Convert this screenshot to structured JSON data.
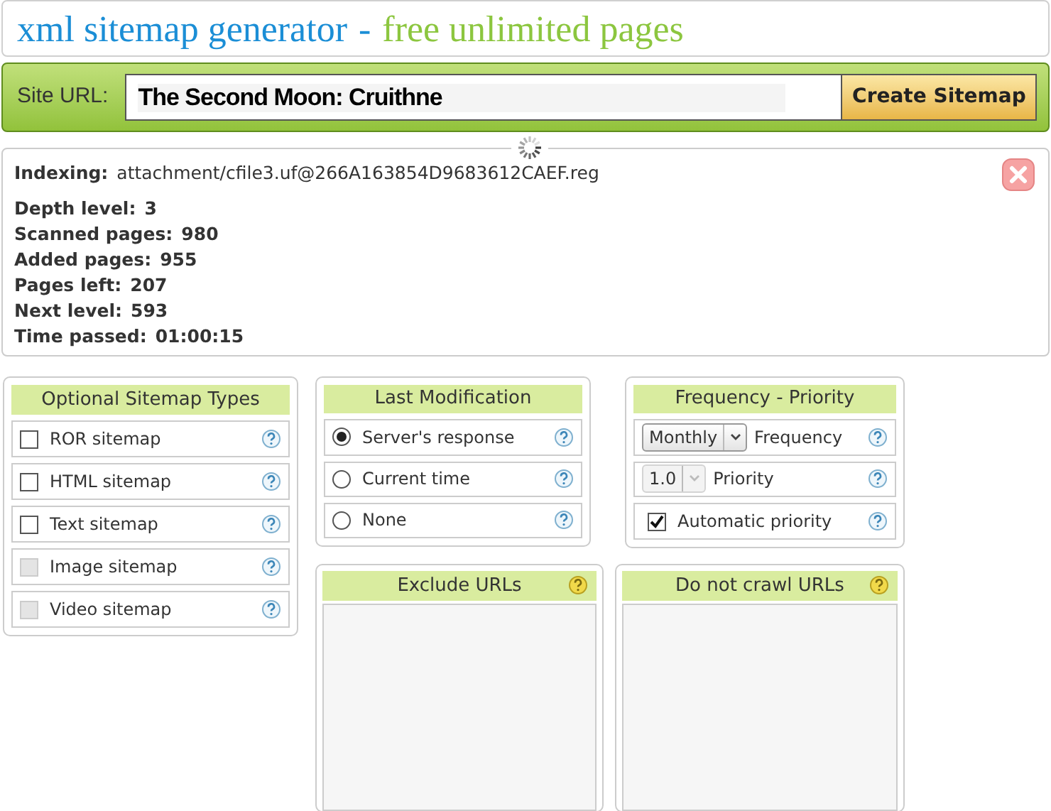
{
  "header": {
    "title": "xml sitemap generator",
    "separator": "-",
    "subtitle": "free unlimited pages"
  },
  "url_bar": {
    "label": "Site URL:",
    "value": "The Second Moon: Cruithne",
    "button": "Create Sitemap"
  },
  "progress": {
    "indexing_label": "Indexing:",
    "indexing_value": "attachment/cfile3.uf@266A163854D9683612CAEF.reg",
    "stats": [
      {
        "label": "Depth level:",
        "value": "3"
      },
      {
        "label": "Scanned pages:",
        "value": "980"
      },
      {
        "label": "Added pages:",
        "value": "955"
      },
      {
        "label": "Pages left:",
        "value": "207"
      },
      {
        "label": "Next level:",
        "value": "593"
      },
      {
        "label": "Time passed:",
        "value": "01:00:15"
      }
    ]
  },
  "sitemap_types": {
    "title": "Optional Sitemap Types",
    "items": [
      {
        "label": "ROR sitemap",
        "checked": false,
        "disabled": false
      },
      {
        "label": "HTML sitemap",
        "checked": false,
        "disabled": false
      },
      {
        "label": "Text sitemap",
        "checked": false,
        "disabled": false
      },
      {
        "label": "Image sitemap",
        "checked": false,
        "disabled": true
      },
      {
        "label": "Video sitemap",
        "checked": false,
        "disabled": true
      }
    ]
  },
  "last_modification": {
    "title": "Last Modification",
    "options": [
      {
        "label": "Server's response",
        "selected": true
      },
      {
        "label": "Current time",
        "selected": false
      },
      {
        "label": "None",
        "selected": false
      }
    ]
  },
  "frequency_priority": {
    "title": "Frequency - Priority",
    "rows": [
      {
        "kind": "select",
        "value": "Monthly",
        "label": "Frequency",
        "disabled": false
      },
      {
        "kind": "select",
        "value": "1.0",
        "label": "Priority",
        "disabled": true
      },
      {
        "kind": "checkbox",
        "label": "Automatic priority",
        "checked": true
      }
    ]
  },
  "exclude_urls": {
    "title": "Exclude URLs"
  },
  "do_not_crawl_urls": {
    "title": "Do not crawl URLs"
  }
}
